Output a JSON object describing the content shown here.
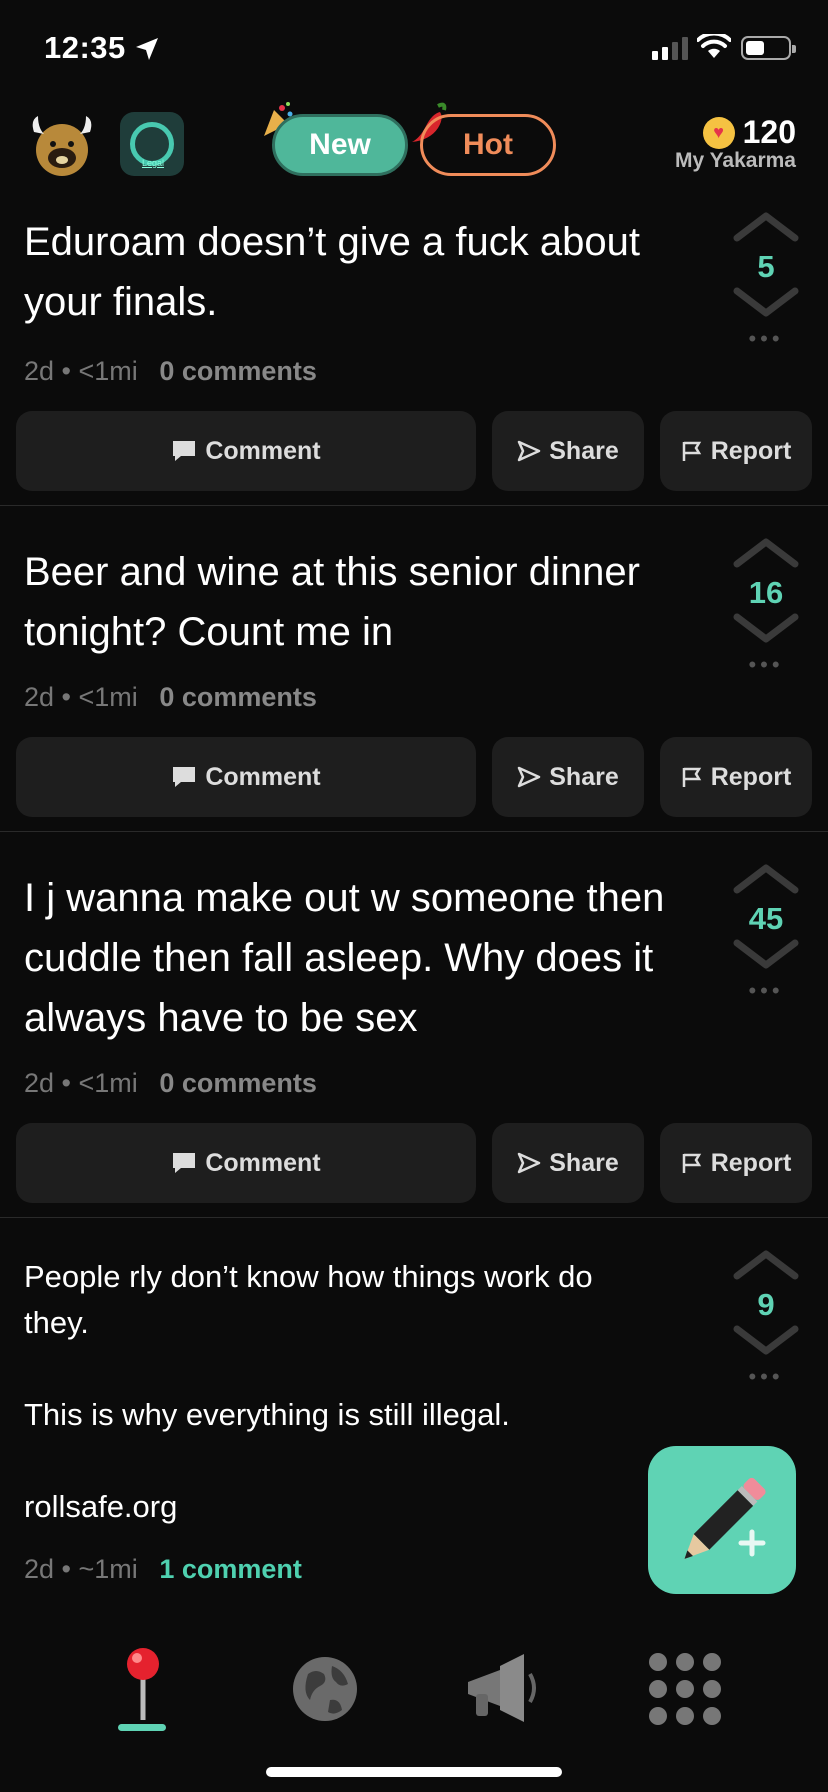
{
  "status_bar": {
    "time": "12:35"
  },
  "header": {
    "tabs": [
      {
        "label": "New",
        "active": true
      },
      {
        "label": "Hot",
        "active": false
      }
    ],
    "yakarma": {
      "score": "120",
      "label": "My Yakarma"
    }
  },
  "actions": {
    "comment": "Comment",
    "share": "Share",
    "report": "Report"
  },
  "posts": [
    {
      "text": "Eduroam doesn’t give a fuck about your finals.",
      "age": "2d",
      "distance": "<1mi",
      "comments": "0 comments",
      "votes": "5"
    },
    {
      "text": "Beer and wine at this senior dinner tonight? Count me in",
      "age": "2d",
      "distance": "<1mi",
      "comments": "0 comments",
      "votes": "16"
    },
    {
      "text": "I j wanna make out w someone then cuddle then fall asleep. Why does it always have to be sex",
      "age": "2d",
      "distance": "<1mi",
      "comments": "0 comments",
      "votes": "45"
    },
    {
      "line1": "People rly don’t know how things work do they.",
      "line2": "This is why everything is still illegal.",
      "line3": "rollsafe.org",
      "age": "2d",
      "distance": "~1mi",
      "comments": "1 comment",
      "votes": "9"
    }
  ],
  "colors": {
    "accent": "#5fd3b4",
    "hot": "#f08c5a",
    "background": "#0b0b0b",
    "card": "#1e1e1e"
  },
  "icons": [
    "location-arrow-icon",
    "signal-icon",
    "wifi-icon",
    "battery-icon",
    "party-popper-icon",
    "chili-icon",
    "heart-coin-icon",
    "chevron-up-icon",
    "chevron-down-icon",
    "more-dots-icon",
    "comment-bubble-icon",
    "share-arrow-icon",
    "flag-icon",
    "pencil-icon",
    "pin-icon",
    "globe-icon",
    "megaphone-icon",
    "grid-icon"
  ]
}
